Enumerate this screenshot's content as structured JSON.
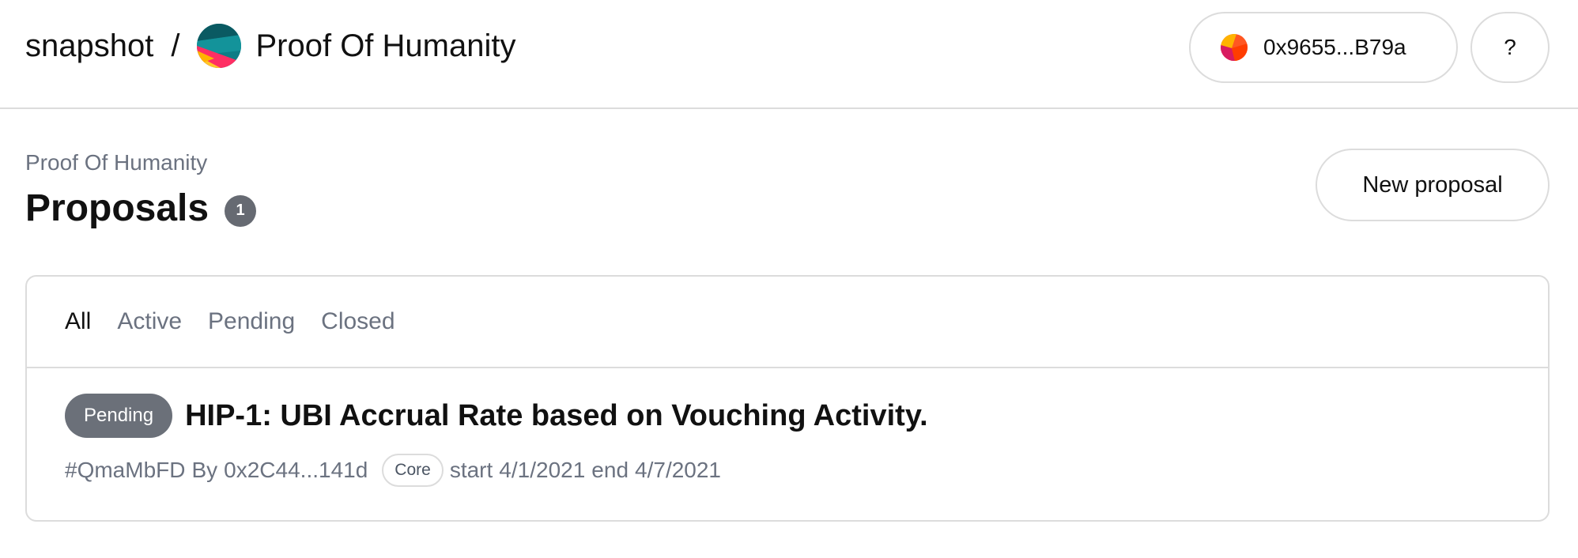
{
  "header": {
    "brand": "snapshot",
    "separator": "/",
    "space_name": "Proof Of Humanity",
    "account_address": "0x9655...B79a",
    "help_label": "?"
  },
  "page": {
    "breadcrumb": "Proof Of Humanity",
    "title": "Proposals",
    "proposal_count": "1",
    "new_proposal_label": "New proposal"
  },
  "tabs": [
    {
      "label": "All",
      "active": true
    },
    {
      "label": "Active",
      "active": false
    },
    {
      "label": "Pending",
      "active": false
    },
    {
      "label": "Closed",
      "active": false
    }
  ],
  "proposals": [
    {
      "state": "Pending",
      "title": "HIP-1: UBI Accrual Rate based on Vouching Activity.",
      "id": "#QmaMbFD",
      "by_label": "By",
      "author": "0x2C44...141d",
      "tag": "Core",
      "start_label": "start",
      "start": "4/1/2021",
      "end_label": "end",
      "end": "4/7/2021"
    }
  ],
  "icons": {
    "space_avatar": "space-avatar-icon",
    "account_avatar": "account-avatar-icon"
  },
  "colors": {
    "border": "#dcdcdc",
    "muted_text": "#6b7280",
    "pending_badge": "#6b7079",
    "count_badge": "#666a72"
  }
}
